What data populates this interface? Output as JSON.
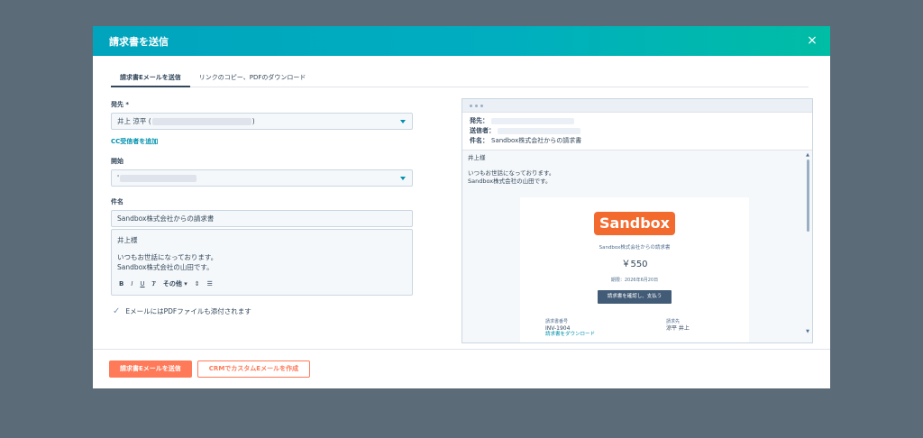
{
  "modal": {
    "title": "請求書を送信",
    "close_glyph": "×"
  },
  "tabs": [
    {
      "label": "請求書Eメールを送信",
      "active": true
    },
    {
      "label": "リンクのコピー、PDFのダウンロード",
      "active": false
    }
  ],
  "form": {
    "from_label": "発先 *",
    "from_name": "井上 涼平 (",
    "from_suffix": ")",
    "cc_link": "CC受信者を追加",
    "open_label": "開始",
    "open_prefix": "'",
    "subject_label": "件名",
    "subject_value": "Sandbox株式会社からの請求書",
    "body_lines": [
      "井上様",
      "いつもお世話になっております。",
      "Sandbox株式会社の山田です。"
    ],
    "toolbar": {
      "bold": "B",
      "italic": "I",
      "underline": "U",
      "clear": "T̷",
      "more": "その他",
      "more_caret": "▾",
      "attach": "⇕",
      "list": "☰"
    },
    "attach_check": "✓",
    "attach_label": "EメールにはPDFファイルも添付されます"
  },
  "preview": {
    "to_label": "発先：",
    "sender_label": "送信者：",
    "subject_label": "件名：",
    "subject_value": "Sandbox株式会社からの請求書",
    "greeting": "井上様",
    "line1": "いつもお世話になっております。",
    "line2": "Sandbox株式会社の山田です。",
    "scroll_up": "▲",
    "scroll_down": "▼",
    "invoice": {
      "logo": "Sandbox",
      "title": "Sandbox株式会社からの請求書",
      "amount": "￥550",
      "due": "期限：2026年6月20日",
      "pay_button": "請求書を確認し、支払う",
      "number_label": "請求書番号",
      "number_value": "INV-1904",
      "download_link": "請求書をダウンロード",
      "billto_label": "請求先",
      "billto_value": "涼平 井上"
    }
  },
  "footer": {
    "send_button": "請求書Eメールを送信",
    "crm_button": "CRMでカスタムEメールを作成"
  }
}
